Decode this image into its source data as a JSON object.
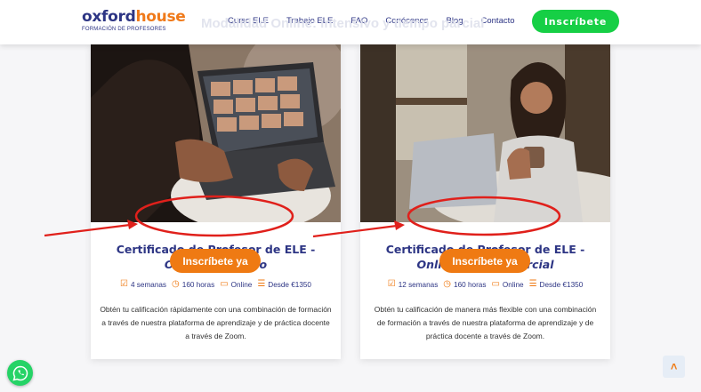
{
  "header": {
    "logo_main_a": "oxford",
    "logo_main_b": "house",
    "logo_sub": "FORMACIÓN DE PROFESORES",
    "ghost_title": "Modalidad Online: intensivo y tiempo parcial",
    "nav": [
      "Curso ELE",
      "Trabajo ELE",
      "FAQ",
      "Conócenos",
      "Blog",
      "Contacto"
    ],
    "cta": "Inscríbete"
  },
  "cards": [
    {
      "enroll": "Inscríbete ya",
      "title": "Certificado de Profesor de ELE -",
      "subtitle": "Online Intensivo",
      "duration": "4 semanas",
      "hours": "160 horas",
      "mode": "Online",
      "price": "Desde €1350",
      "description": "Obtén tu calificación rápidamente con una combinación de formación a través de nuestra plataforma de aprendizaje y de práctica docente a través de Zoom."
    },
    {
      "enroll": "Inscríbete ya",
      "title": "Certificado de Profesor de ELE -",
      "subtitle": "Online Tiempo parcial",
      "duration": "12 semanas",
      "hours": "160 horas",
      "mode": "Online",
      "price": "Desde €1350",
      "description": "Obtén tu calificación de manera más flexible con una combinación de formación a través de nuestra plataforma de aprendizaje y de práctica docente a través de Zoom."
    }
  ],
  "colors": {
    "brand_blue": "#2d3584",
    "brand_orange": "#ef7a13",
    "cta_green": "#16cf45",
    "annotation_red": "#e0201b"
  },
  "icons": {
    "calendar": "calendar-check-icon",
    "clock": "clock-icon",
    "laptop": "laptop-icon",
    "cart": "cart-icon",
    "whatsapp": "whatsapp-icon",
    "scroll_top": "double-chevron-up-icon"
  }
}
